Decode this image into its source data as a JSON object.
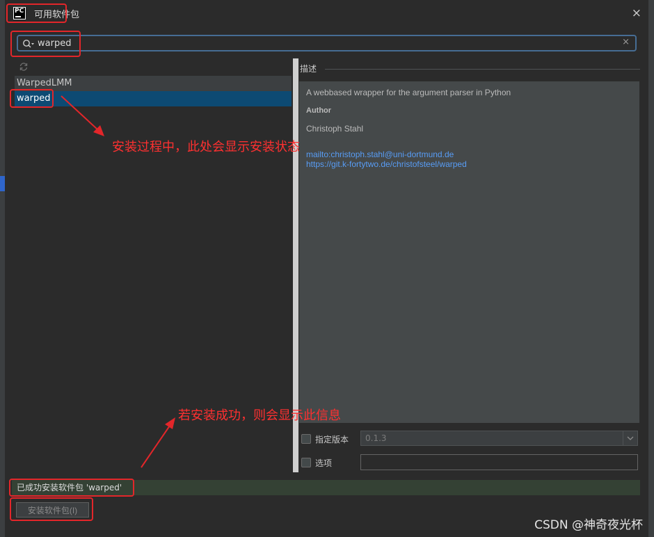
{
  "window": {
    "app_icon": "PC",
    "title": "可用软件包",
    "close_icon": "×"
  },
  "search": {
    "value": "warped",
    "clear_icon": "×"
  },
  "packages": [
    {
      "name": "WarpedLMM",
      "selected": false
    },
    {
      "name": "warped",
      "selected": true
    }
  ],
  "description": {
    "section_label": "描述",
    "summary": "A webbased wrapper for the argument parser in Python",
    "author_label": "Author",
    "author": "Christoph Stahl",
    "links": [
      "mailto:christoph.stahl@uni-dortmund.de",
      "https://git.k-fortytwo.de/christofsteel/warped"
    ]
  },
  "options": {
    "specify_version_label": "指定版本",
    "version_value": "0.1.3",
    "options_label": "选项",
    "options_value": ""
  },
  "status": {
    "message": "已成功安装软件包 'warped'"
  },
  "install_button": {
    "label": "安装软件包(I)"
  },
  "annotations": {
    "install_status_note": "安装过程中，此处会显示安装状态",
    "success_note": "若安装成功，则会显示此信息"
  },
  "watermark": "CSDN @神奇夜光杯",
  "colors": {
    "annotation": "#e3262a",
    "selection": "#0d4a73",
    "link": "#589df6",
    "success_bar": "#344134"
  }
}
